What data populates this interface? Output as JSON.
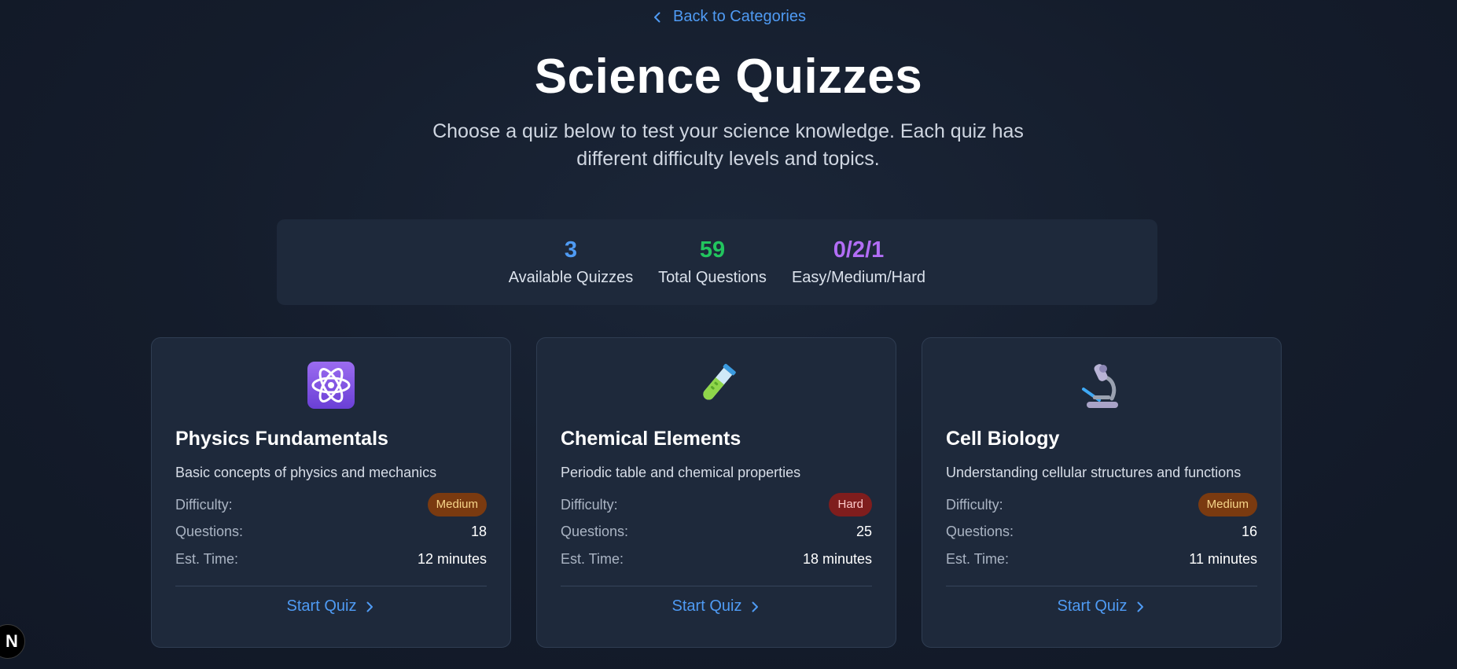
{
  "nav": {
    "back_label": "Back to Categories"
  },
  "header": {
    "title": "Science Quizzes",
    "subtitle": "Choose a quiz below to test your science knowledge. Each quiz has different difficulty levels and topics."
  },
  "stats": [
    {
      "value": "3",
      "label": "Available Quizzes",
      "color": "#4f9bf4"
    },
    {
      "value": "59",
      "label": "Total Questions",
      "color": "#22c55e"
    },
    {
      "value": "0/2/1",
      "label": "Easy/Medium/Hard",
      "color": "#b26df5"
    }
  ],
  "labels": {
    "difficulty": "Difficulty:",
    "questions": "Questions:",
    "time": "Est. Time:",
    "start": "Start Quiz"
  },
  "quizzes": [
    {
      "icon": "atom-icon",
      "title": "Physics Fundamentals",
      "description": "Basic concepts of physics and mechanics",
      "difficulty": "Medium",
      "questions": "18",
      "time": "12 minutes"
    },
    {
      "icon": "test-tube-icon",
      "title": "Chemical Elements",
      "description": "Periodic table and chemical properties",
      "difficulty": "Hard",
      "questions": "25",
      "time": "18 minutes"
    },
    {
      "icon": "microscope-icon",
      "title": "Cell Biology",
      "description": "Understanding cellular structures and functions",
      "difficulty": "Medium",
      "questions": "16",
      "time": "11 minutes"
    }
  ],
  "floating_logo": {
    "letter": "N"
  }
}
